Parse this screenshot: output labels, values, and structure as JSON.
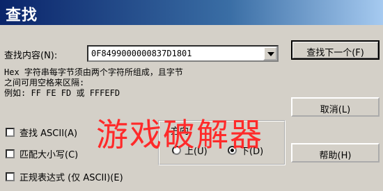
{
  "window": {
    "title": "查找"
  },
  "find": {
    "label": "查找内容(N):",
    "value": "0F8499000000837D1801"
  },
  "hint": {
    "line1": "Hex 字符串每字节须由两个字符所组成，且字节",
    "line2": "之间可用空格来区隔:",
    "line3": "例如: FF FE FD 或 FFFEFD"
  },
  "options": {
    "find_ascii": "查找 ASCII(A)",
    "match_case": "匹配大小写(C)",
    "regex": "正规表达式 (仅 ASCII)(E)"
  },
  "direction": {
    "label": "方向",
    "up": "上(U)",
    "down": "下(D)",
    "selected": "down"
  },
  "buttons": {
    "find_next": "查找下一个(F)",
    "cancel": "取消(L)",
    "help": "帮助(H)"
  },
  "watermark": "游戏破解器",
  "colors": {
    "titlebar_start": "#0a246a",
    "titlebar_end": "#a6caf0",
    "dialog_bg": "#d4d0c8",
    "watermark": "#ff2a2a"
  }
}
